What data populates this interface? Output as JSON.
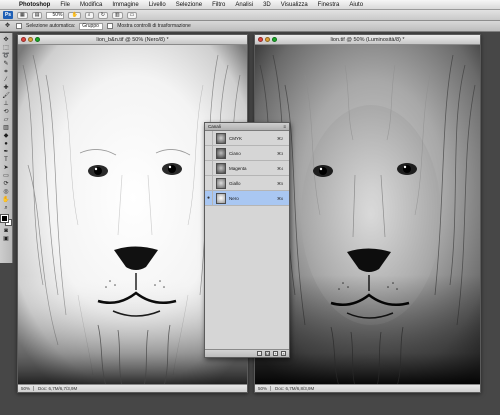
{
  "menubar": {
    "apple": "",
    "items": [
      "Photoshop",
      "File",
      "Modifica",
      "Immagine",
      "Livello",
      "Selezione",
      "Filtro",
      "Analisi",
      "3D",
      "Visualizza",
      "Finestra",
      "Aiuto"
    ]
  },
  "appbar": {
    "logo": "Ps",
    "zoom": "50%"
  },
  "optbar": {
    "auto_select_label": "Selezione automatica:",
    "auto_select_value": "Gruppo",
    "transform_label": "Mostra controlli di trasformazione"
  },
  "left_window": {
    "title": "lion_b&n.tif @ 50% (Nero/8) *",
    "zoom": "50%",
    "doc": "Doc: 6,7M/6,7/3,9M"
  },
  "right_window": {
    "title": "lion.tif @ 50% (Luminosità/8) *",
    "zoom": "50%",
    "doc": "Doc: 6,7M/6,8/3,9M"
  },
  "channels_panel": {
    "title": "Canali",
    "channels": [
      {
        "name": "CMYK",
        "shortcut": "⌘2",
        "visible": false,
        "selected": false
      },
      {
        "name": "Ciano",
        "shortcut": "⌘3",
        "visible": false,
        "selected": false
      },
      {
        "name": "Magenta",
        "shortcut": "⌘4",
        "visible": false,
        "selected": false
      },
      {
        "name": "Giallo",
        "shortcut": "⌘5",
        "visible": false,
        "selected": false
      },
      {
        "name": "Nero",
        "shortcut": "⌘6",
        "visible": true,
        "selected": true
      }
    ]
  },
  "colors": {
    "accent": "#1f5fb5",
    "selected_row": "#a9c7f2",
    "close": "#e0443e",
    "minimize": "#dea236",
    "zoom": "#1aab29"
  }
}
